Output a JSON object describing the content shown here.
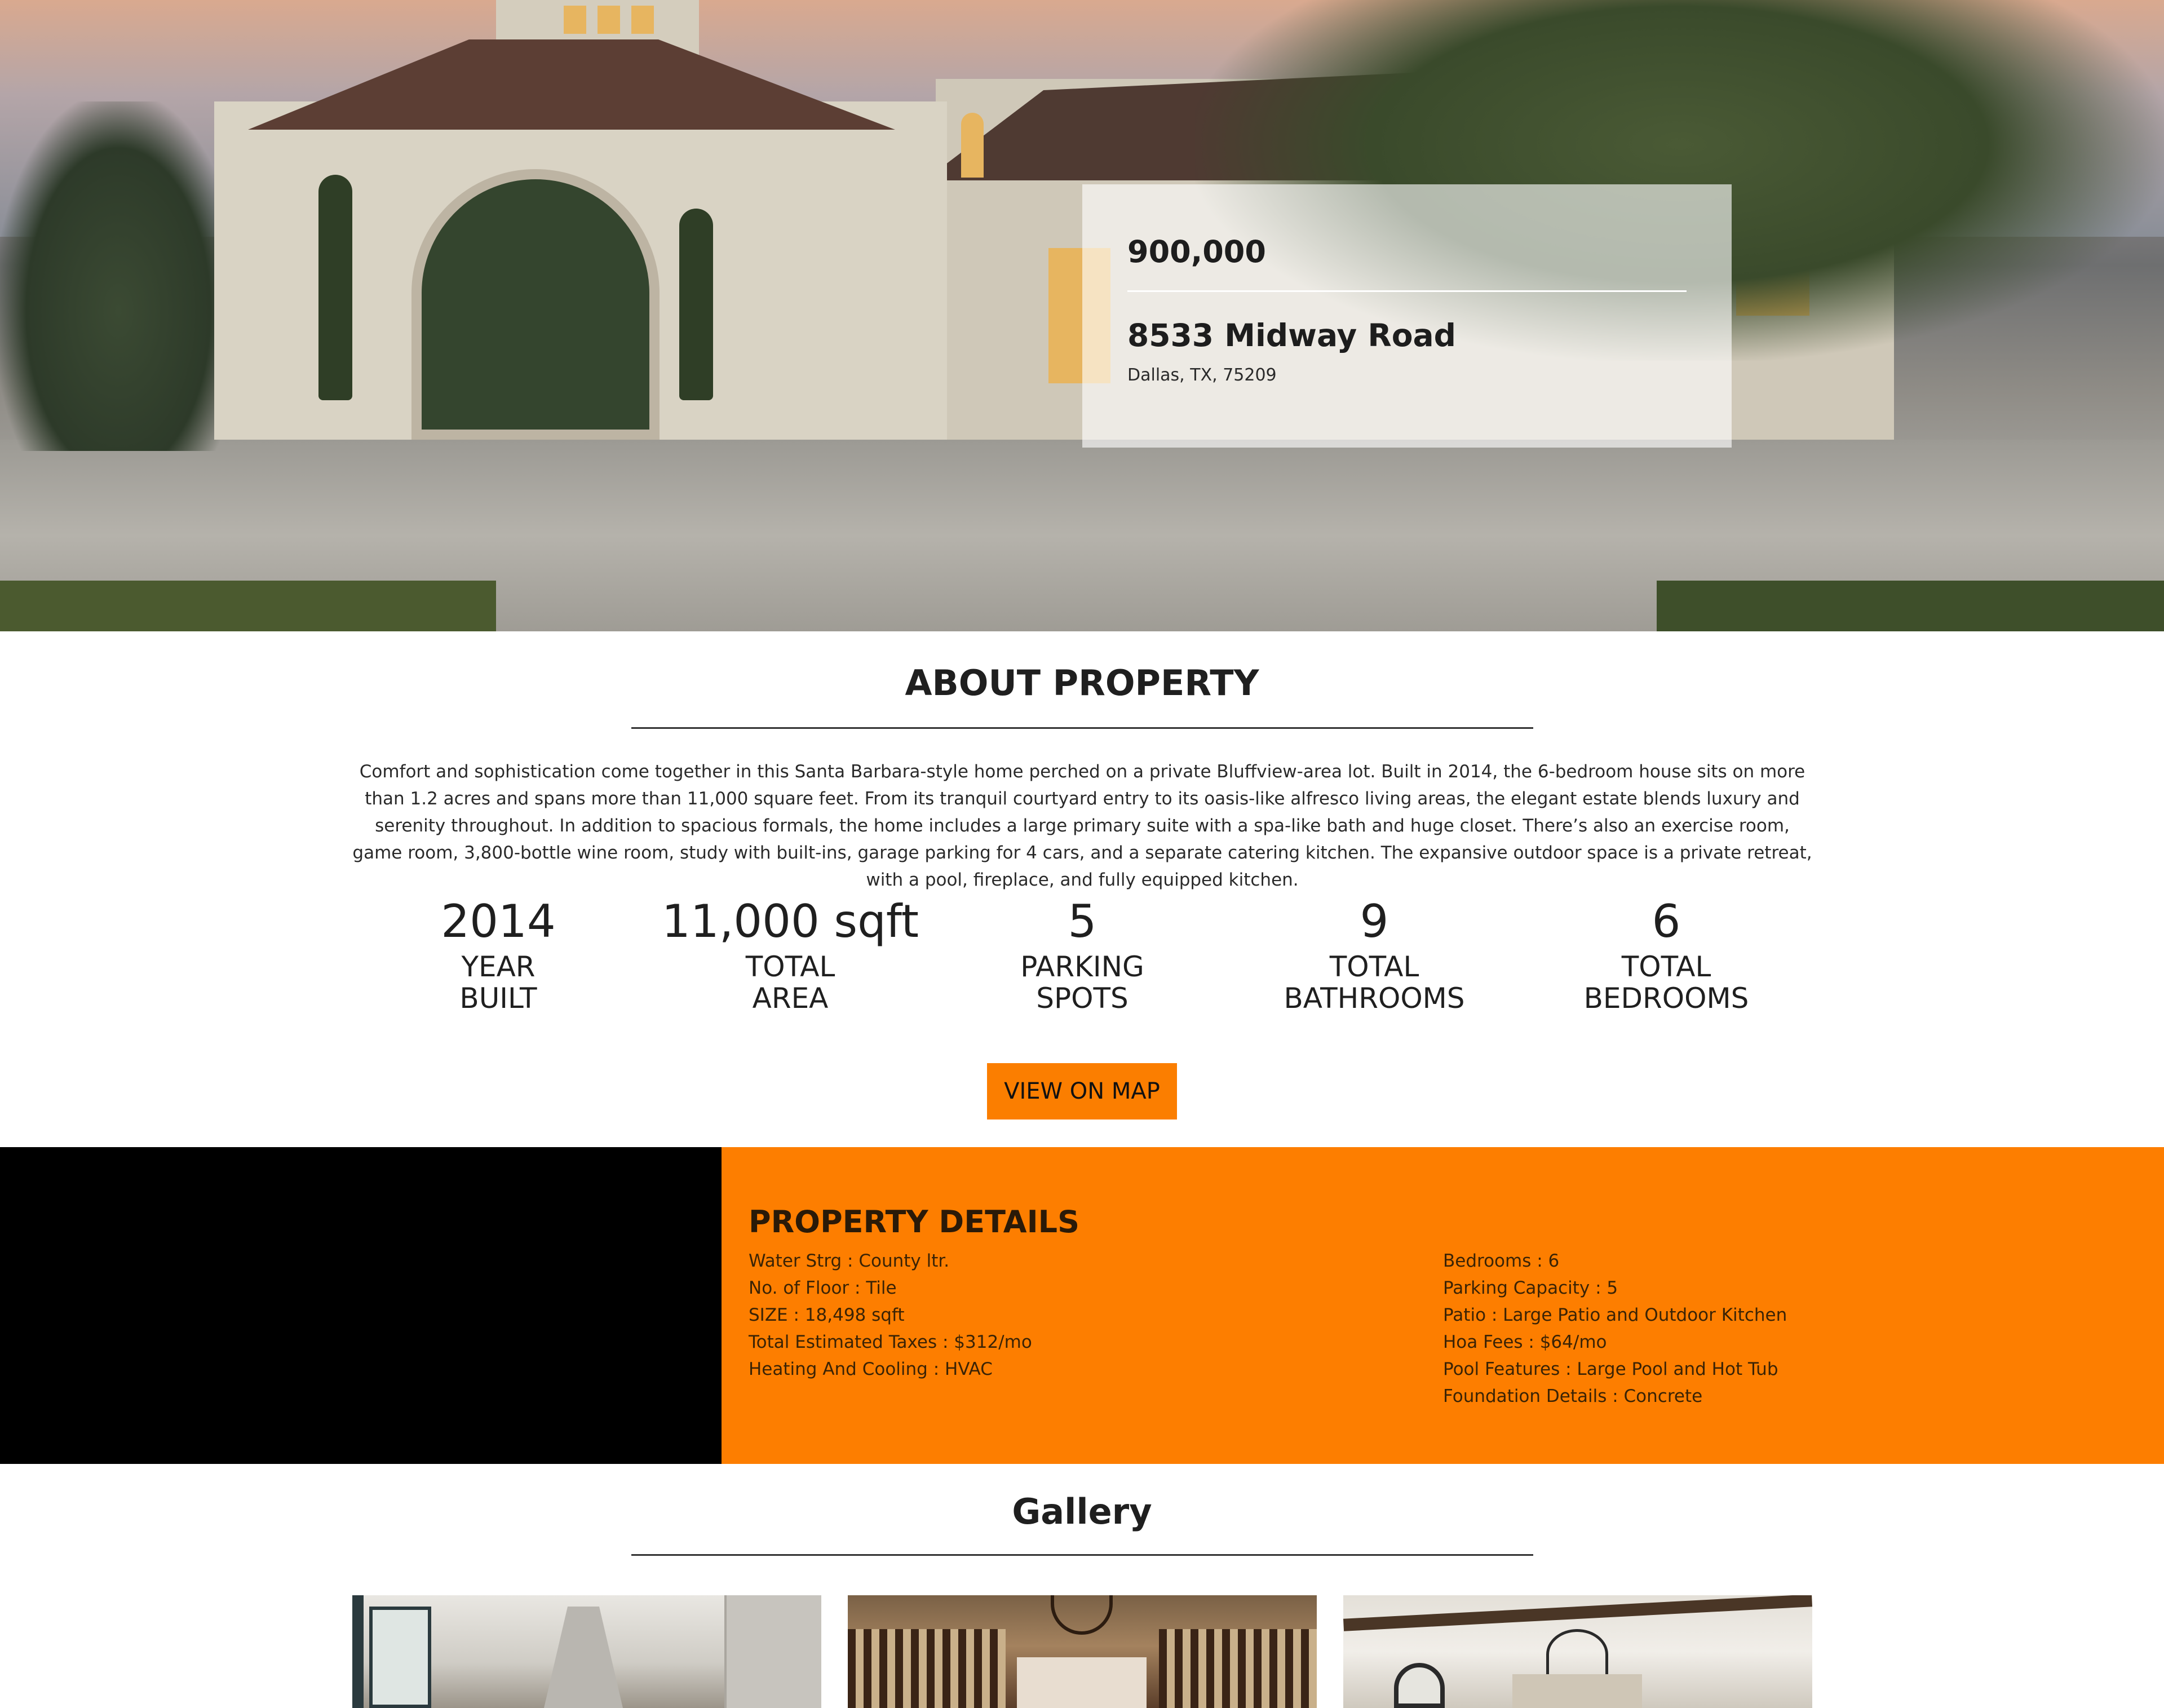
{
  "hero": {
    "price": "900,000",
    "address": "8533 Midway Road",
    "city": "Dallas, TX, 75209"
  },
  "about": {
    "title": "ABOUT PROPERTY",
    "description": "Comfort and sophistication come together in this Santa Barbara-style home perched on a private Bluffview-area lot. Built in 2014, the 6-bedroom house sits on more than 1.2 acres and spans more than 11,000 square feet. From its tranquil courtyard entry to its oasis-like alfresco living areas, the elegant estate blends luxury and serenity throughout. In addition to spacious formals, the home includes a large primary suite with a spa-like bath and huge closet. There’s also an exercise room, game room, 3,800-bottle wine room, study with built-ins, garage parking for 4 cars, and a separate catering kitchen. The expansive outdoor space is a private retreat, with a pool, fireplace, and fully equipped kitchen.",
    "stats": [
      {
        "value": "2014",
        "label_line1": "YEAR",
        "label_line2": "BUILT"
      },
      {
        "value": "11,000 sqft",
        "label_line1": "TOTAL",
        "label_line2": "AREA"
      },
      {
        "value": "5",
        "label_line1": "PARKING",
        "label_line2": "SPOTS"
      },
      {
        "value": "9",
        "label_line1": "TOTAL",
        "label_line2": "BATHROOMS"
      },
      {
        "value": "6",
        "label_line1": "TOTAL",
        "label_line2": "BEDROOMS"
      }
    ],
    "map_button": "VIEW ON MAP"
  },
  "details": {
    "title": "PROPERTY DETAILS",
    "left": [
      "Water Strg : County ltr.",
      "No. of Floor : Tile",
      "SIZE : 18,498 sqft",
      "Total Estimated Taxes : $312/mo",
      "Heating And Cooling : HVAC"
    ],
    "right": [
      "Bedrooms : 6",
      "Parking Capacity : 5",
      "Patio : Large Patio and Outdoor Kitchen",
      "Hoa Fees : $64/mo",
      "Pool Features : Large Pool and Hot Tub",
      "Foundation Details : Concrete"
    ]
  },
  "gallery": {
    "title": "Gallery"
  },
  "colors": {
    "accent_orange": "#fd7e00",
    "details_left_panel": "#000000",
    "text_dark": "#222222"
  }
}
